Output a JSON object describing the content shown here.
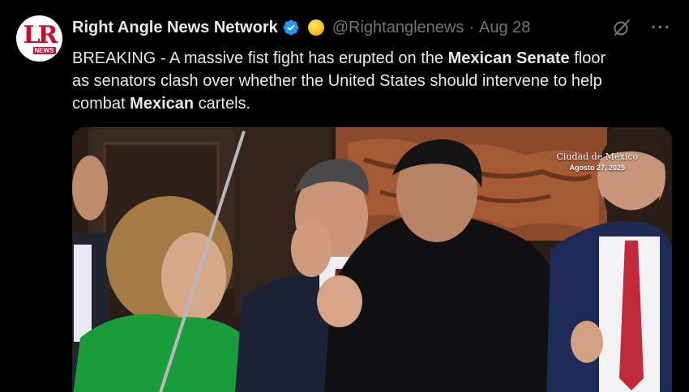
{
  "author": {
    "display_name": "Right Angle News Network",
    "handle": "@Rightanglenews",
    "separator": "·",
    "date": "Aug 28",
    "avatar_letters": "LR",
    "avatar_badge": "NEWS"
  },
  "icons": {
    "verified": "verified-badge-icon",
    "affiliate": "gold-affiliate-icon",
    "grok": "grok-icon",
    "more": "more-options-icon"
  },
  "colors": {
    "background": "#000000",
    "text": "#e7e9ea",
    "secondary": "#71767b",
    "verified": "#1d9bf0",
    "brand_red": "#c8102e"
  },
  "tweet": {
    "prefix": "BREAKING - A massive fist fight has erupted on the ",
    "bold_1": "Mexican Senate",
    "middle_1": " floor",
    "line_2": "as senators clash over whether the United States should intervene to help",
    "line_3_start": "combat ",
    "bold_2": "Mexican",
    "line_3_end": " cartels."
  },
  "media": {
    "caption_place": "Ciudad de México",
    "caption_date": "Agosto 27, 2025"
  }
}
